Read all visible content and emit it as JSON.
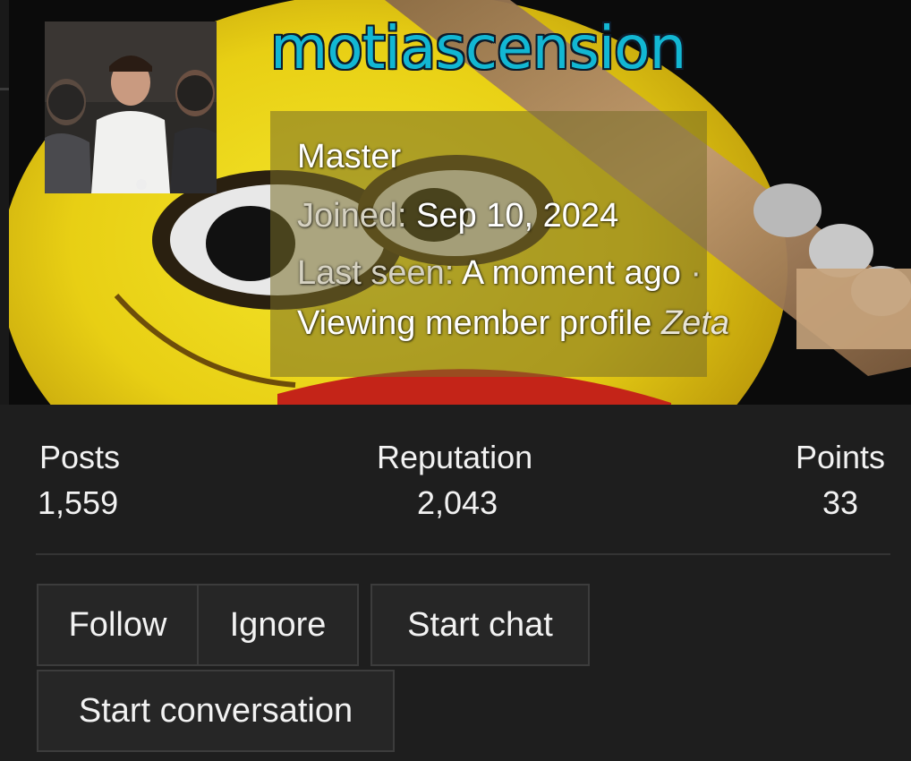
{
  "profile": {
    "username": "motiascension",
    "title": "Master",
    "joined_label": "Joined:",
    "joined_value": "Sep 10, 2024",
    "last_seen_label": "Last seen:",
    "last_seen_value": "A moment ago",
    "separator": "·",
    "activity_prefix": "Viewing member profile",
    "activity_target": "Zeta"
  },
  "stats": {
    "posts_label": "Posts",
    "posts_value": "1,559",
    "reputation_label": "Reputation",
    "reputation_value": "2,043",
    "points_label": "Points",
    "points_value": "33"
  },
  "actions": {
    "follow": "Follow",
    "ignore": "Ignore",
    "start_chat": "Start chat",
    "start_conversation": "Start conversation"
  },
  "colors": {
    "username": "#12b7d3",
    "background": "#1e1e1e",
    "button_bg": "#262626",
    "info_box": "#786e28"
  }
}
